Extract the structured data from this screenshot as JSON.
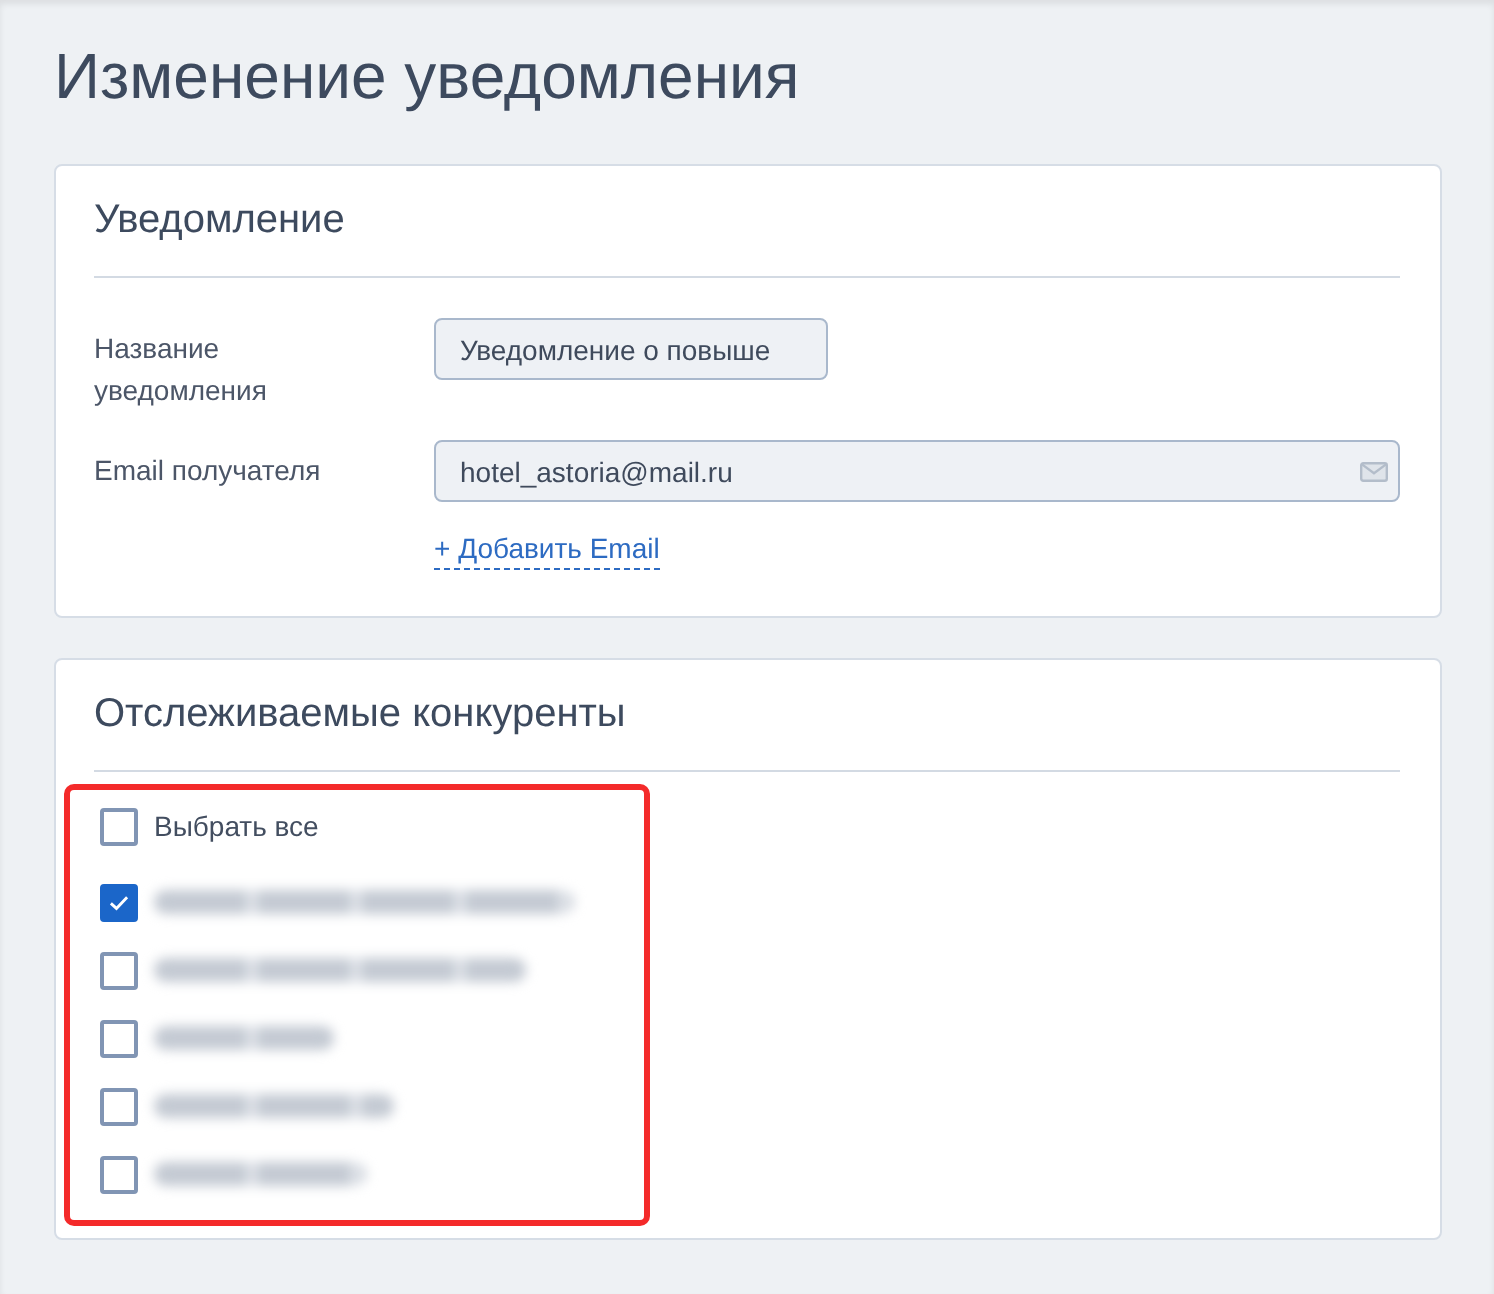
{
  "page": {
    "title": "Изменение уведомления"
  },
  "notification_card": {
    "heading": "Уведомление",
    "fields": [
      {
        "kind": "text",
        "label": "Название уведомления",
        "value": "Уведомление о повыше"
      },
      {
        "kind": "email",
        "label": "Email получателя",
        "value": "hotel_astoria@mail.ru"
      }
    ],
    "add_link": "+ Добавить Email"
  },
  "competitors_card": {
    "heading": "Отслеживаемые конкуренты",
    "highlighted": true,
    "select_all": {
      "label": "Выбрать все",
      "checked": false
    },
    "items": [
      {
        "checked": true
      },
      {
        "checked": false
      },
      {
        "checked": false
      },
      {
        "checked": false
      },
      {
        "checked": false
      }
    ]
  }
}
